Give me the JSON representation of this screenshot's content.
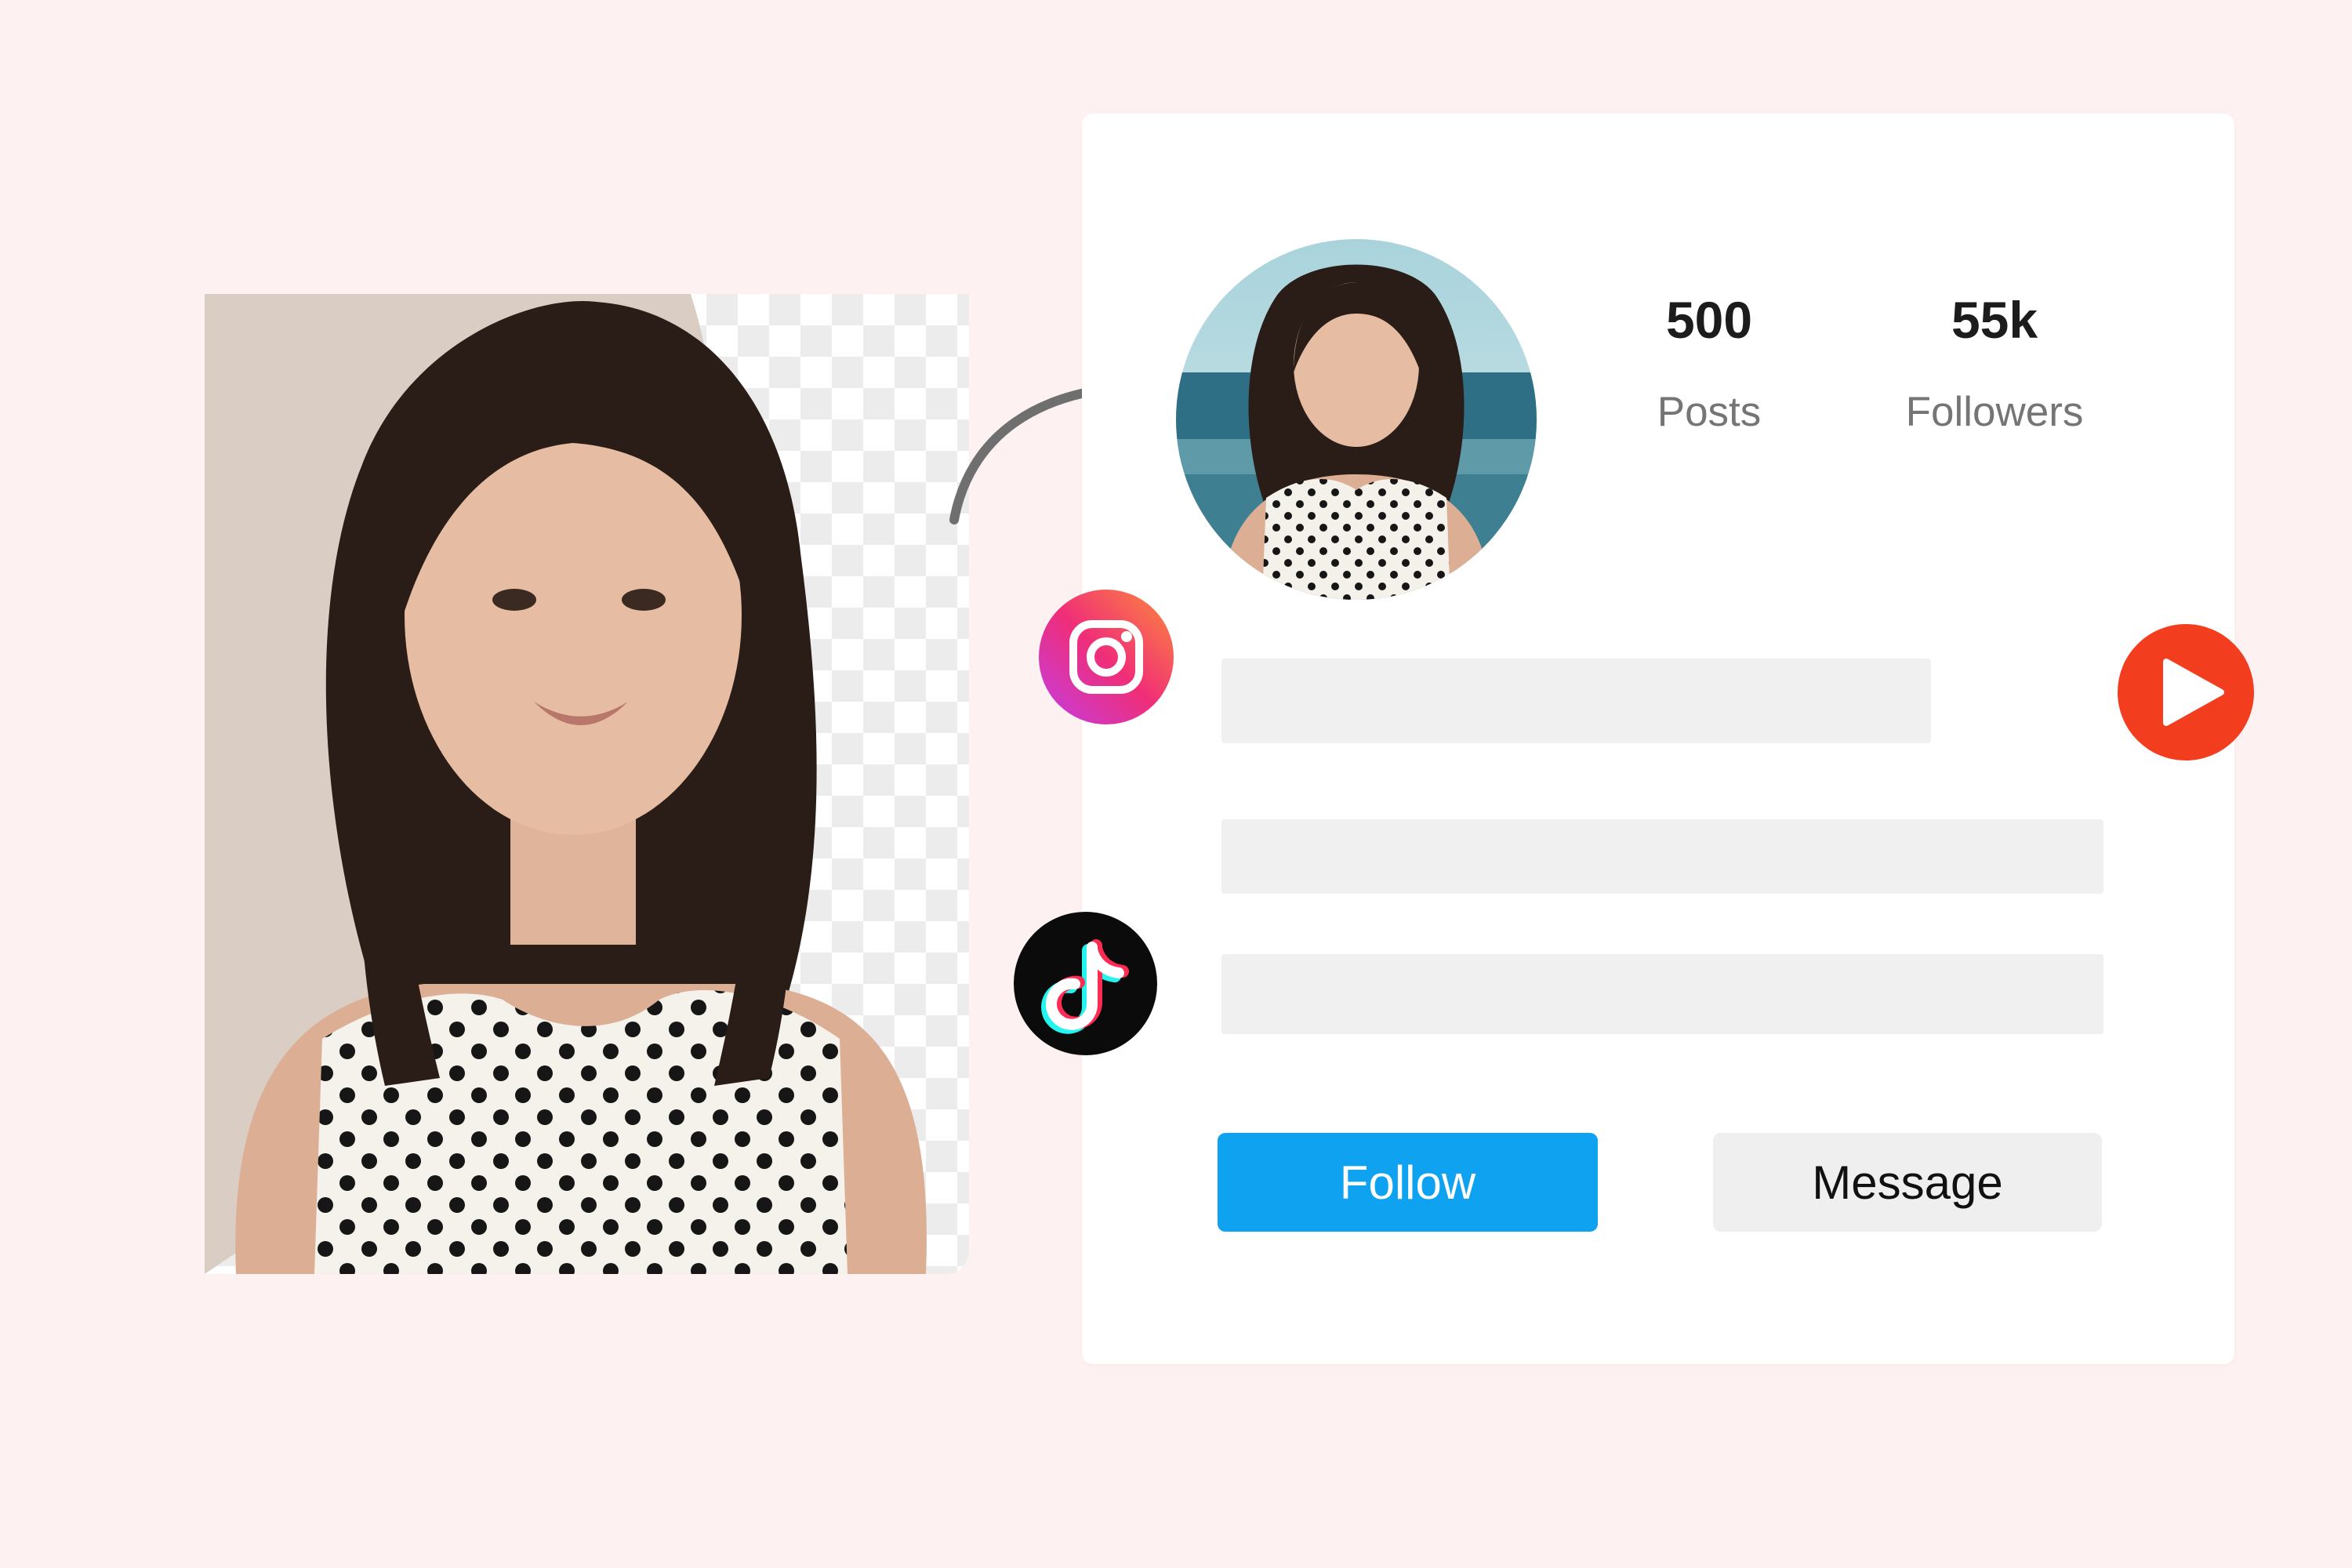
{
  "profile": {
    "posts_count": "500",
    "posts_label": "Posts",
    "followers_count": "55k",
    "followers_label": "Followers"
  },
  "buttons": {
    "follow_label": "Follow",
    "message_label": "Message"
  },
  "icons": {
    "instagram": "instagram-icon",
    "tiktok": "tiktok-icon",
    "play": "play-icon",
    "arrow": "curved-arrow-icon"
  },
  "colors": {
    "background": "#fdf1f1",
    "follow_button": "#0ea2f1",
    "message_button": "#efefef",
    "play_icon": "#f23d1e"
  }
}
